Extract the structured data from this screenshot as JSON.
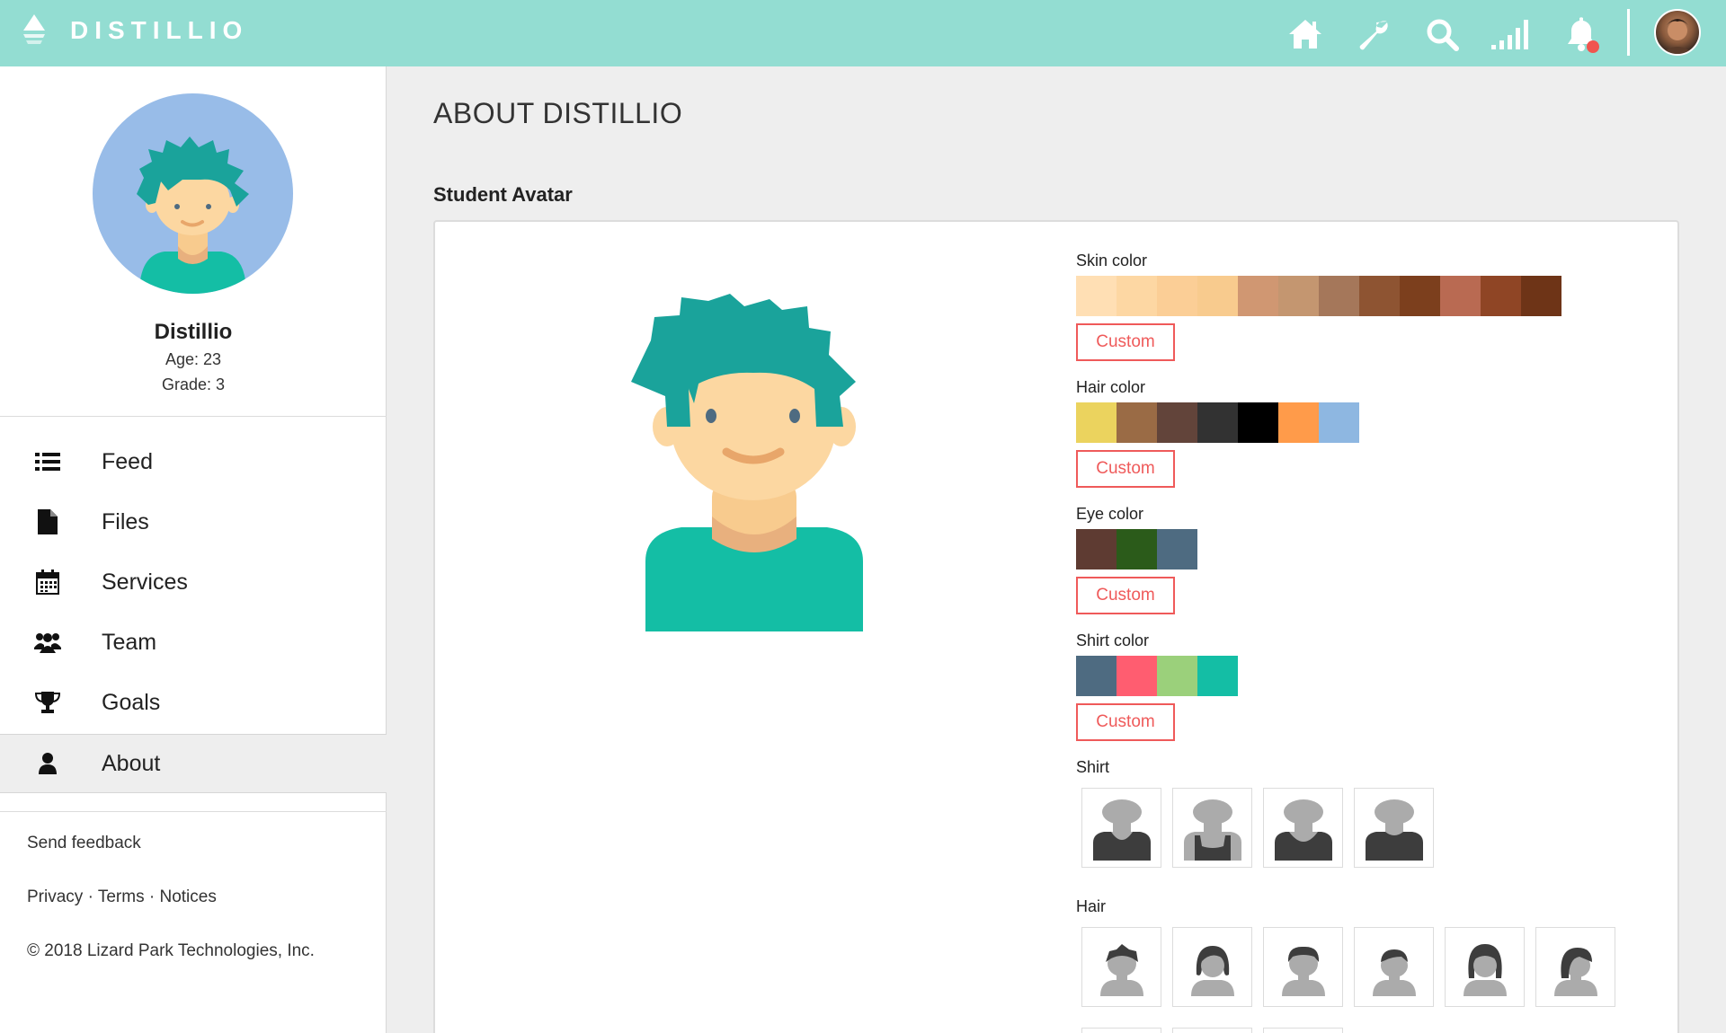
{
  "app": {
    "brand": "DISTILLIO"
  },
  "topbar": {
    "icons": [
      "home-icon",
      "wrench-icon",
      "search-icon",
      "signal-icon",
      "bell-icon"
    ]
  },
  "profile": {
    "name": "Distillio",
    "age": "Age: 23",
    "grade": "Grade: 3"
  },
  "nav": {
    "items": [
      {
        "label": "Feed",
        "icon": "list-icon"
      },
      {
        "label": "Files",
        "icon": "file-icon"
      },
      {
        "label": "Services",
        "icon": "calendar-icon"
      },
      {
        "label": "Team",
        "icon": "users-icon"
      },
      {
        "label": "Goals",
        "icon": "trophy-icon"
      },
      {
        "label": "About",
        "icon": "user-icon",
        "active": true
      }
    ]
  },
  "footer": {
    "feedback": "Send feedback",
    "privacy": "Privacy",
    "terms": "Terms",
    "notices": "Notices",
    "sep": "·",
    "copyright": "© 2018 Lizard Park Technologies, Inc."
  },
  "main": {
    "title": "ABOUT DISTILLIO",
    "section": "Student Avatar"
  },
  "options": {
    "skin": {
      "label": "Skin color",
      "custom": "Custom",
      "swatches": [
        "#ffdfb4",
        "#fdd7a3",
        "#fbce96",
        "#f8cb8e",
        "#d09772",
        "#c49670",
        "#a5775a",
        "#8e5432",
        "#7c3f1d",
        "#b96a52",
        "#8f4525",
        "#6e3417"
      ]
    },
    "hair": {
      "label": "Hair color",
      "custom": "Custom",
      "swatches": [
        "#ebd35e",
        "#9a6b45",
        "#62443a",
        "#323232",
        "#000000",
        "#ff9b4a",
        "#8eb7e1"
      ]
    },
    "eye": {
      "label": "Eye color",
      "custom": "Custom",
      "swatches": [
        "#5e3b32",
        "#2b5b1a",
        "#4e6b81"
      ]
    },
    "shirt_color": {
      "label": "Shirt color",
      "custom": "Custom",
      "swatches": [
        "#4e6b81",
        "#ff5d70",
        "#9bd07b",
        "#14bea5"
      ]
    },
    "shirt": {
      "label": "Shirt"
    },
    "hair_style": {
      "label": "Hair"
    }
  }
}
